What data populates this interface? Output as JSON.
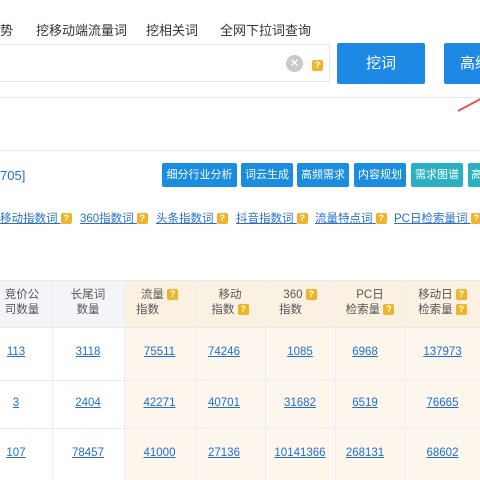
{
  "nav": {
    "tabs": [
      "势",
      "挖移动端流量词",
      "挖相关词",
      "全网下拉词查询"
    ]
  },
  "search": {
    "clear_label": "✕",
    "help_label": "?",
    "submit_label": "挖词",
    "advanced_label": "高级"
  },
  "results": {
    "count_text": "705]"
  },
  "tools": [
    "细分行业分析",
    "词云生成",
    "高频需求",
    "内容规划",
    "需求图谱",
    "高"
  ],
  "metrics": [
    "移动指数词",
    "360指数词",
    "头条指数词",
    "抖音指数词",
    "流量特点词",
    "PC日检索量词"
  ],
  "table": {
    "headers": [
      {
        "line1": "竞价公",
        "line2": "司数量",
        "help": false
      },
      {
        "line1": "长尾词",
        "line2": "数量",
        "help": false
      },
      {
        "line1": "流量",
        "line2": "指数",
        "help": true
      },
      {
        "line1": "移动",
        "line2": "指数",
        "help": true
      },
      {
        "line1": "360",
        "line2": "指数",
        "help": true
      },
      {
        "line1": "PC日",
        "line2": "检索量",
        "help": true
      },
      {
        "line1": "移动日",
        "line2": "检索量",
        "help": true
      }
    ],
    "rows": [
      [
        "113",
        "3118",
        "75511",
        "74246",
        "1085",
        "6968",
        "137973"
      ],
      [
        "3",
        "2404",
        "42271",
        "40701",
        "31682",
        "6519",
        "76665"
      ],
      [
        "107",
        "78457",
        "41000",
        "27136",
        "10141366",
        "268131",
        "68602"
      ]
    ]
  },
  "colors": {
    "primary": "#1e88e5",
    "link": "#1e6fd9",
    "help_icon": "#f0b429",
    "highlight_bg": "#fdf6ec"
  }
}
